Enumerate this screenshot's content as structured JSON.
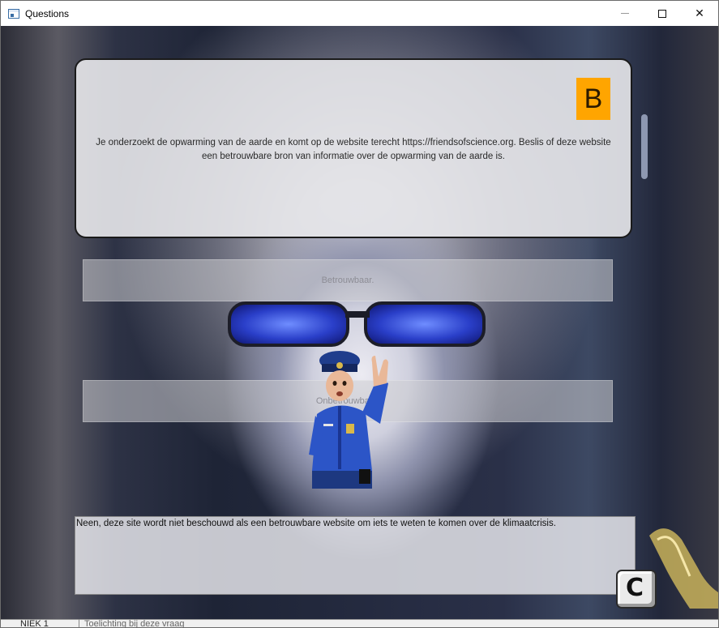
{
  "window": {
    "title": "Questions",
    "controls": {
      "minimize": "minimize",
      "maximize": "maximize",
      "close": "✕"
    }
  },
  "question": {
    "badge": "B",
    "text": "Je onderzoekt de opwarming van de aarde en komt op de website terecht https://friendsofscience.org. Beslis of deze website een betrouwbare bron van informatie over de opwarming van de aarde is."
  },
  "answers": [
    {
      "label": "Betrouwbaar."
    },
    {
      "label": "Onbetrouwbaar."
    }
  ],
  "feedback": {
    "text": "Neen, deze site wordt niet beschouwd als een betrouwbare website om iets te weten te komen over de klimaatcrisis."
  },
  "key_hint": {
    "label": "C"
  },
  "underlying_window": {
    "left_text": "NIEK 1",
    "right_text": "Toelichting bij deze vraag"
  },
  "colors": {
    "badge": "#ffa500",
    "panel": "#e8e8eb"
  }
}
